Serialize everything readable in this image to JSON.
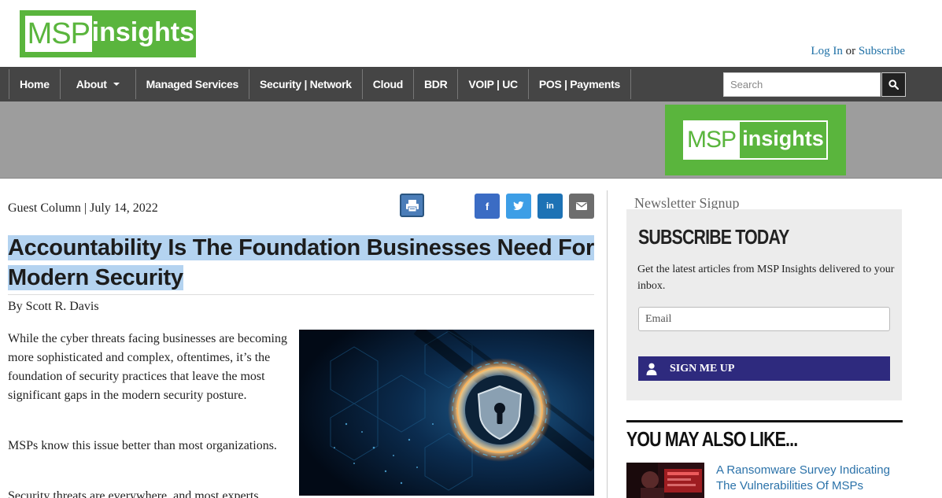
{
  "header": {
    "logo_msp": "MSP",
    "logo_insights": "insights",
    "login": "Log In",
    "or": "or",
    "subscribe": "Subscribe"
  },
  "nav": {
    "items": [
      "Home",
      "About",
      "Managed Services",
      "Security | Network",
      "Cloud",
      "BDR",
      "VOIP | UC",
      "POS | Payments"
    ],
    "search_placeholder": "Search"
  },
  "banner": {
    "logo_msp": "MSP",
    "logo_insights": "insights"
  },
  "article": {
    "meta": "Guest Column | July 14, 2022",
    "share": {
      "facebook": "f",
      "linkedin": "in"
    },
    "title": "Accountability Is The Foundation Businesses Need For Modern Security",
    "byline": "By Scott R. Davis",
    "paragraphs": [
      "While the cyber threats facing businesses are becoming more sophisticated and complex, oftentimes, it’s the foundation of security practices that leave the most significant gaps in the modern security posture.",
      "MSPs know this issue better than most organizations.",
      "Security threats are everywhere, and most experts"
    ]
  },
  "sidebar": {
    "heading": "Newsletter Signup",
    "subscribe_title": "SUBSCRIBE TODAY",
    "description": "Get the latest articles from MSP Insights delivered to your inbox.",
    "email_placeholder": "Email",
    "signup_label": "SIGN ME UP",
    "also_title": "YOU MAY ALSO LIKE...",
    "related": [
      {
        "title": "A Ransomware Survey Indicating The Vulnerabilities Of MSPs"
      }
    ]
  },
  "colors": {
    "brand_green": "#5ab53d",
    "nav_bg": "#454545",
    "signup_button": "#2e2a7e",
    "link": "#1d6fa5"
  }
}
